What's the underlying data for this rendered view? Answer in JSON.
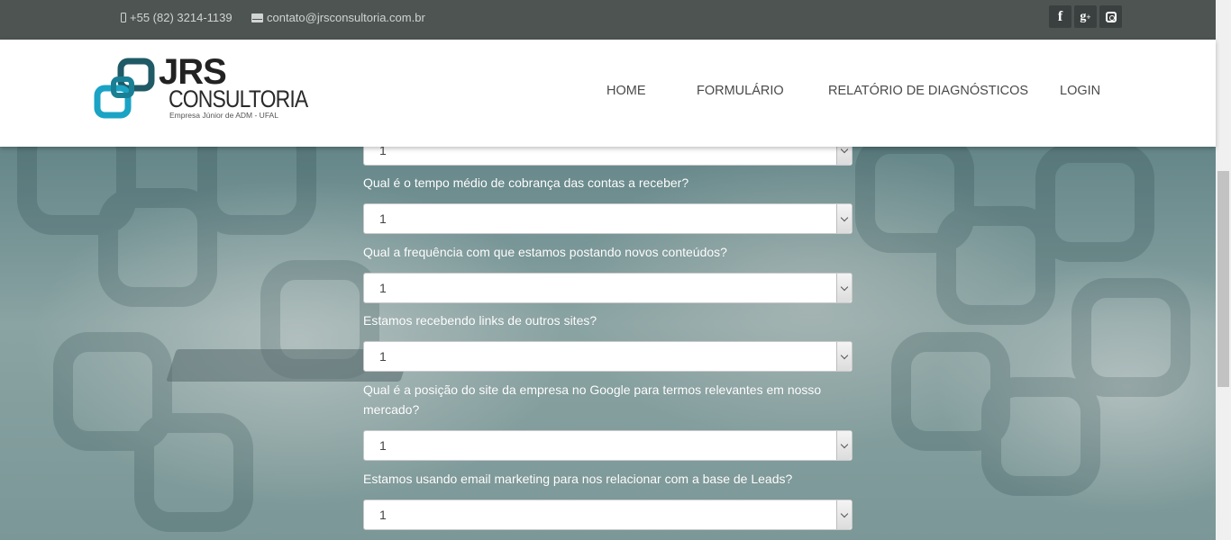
{
  "topbar": {
    "phone": "+55 (82) 3214-1139",
    "email": "contato@jrsconsultoria.com.br",
    "social": [
      "facebook-icon",
      "google-plus-icon",
      "instagram-icon"
    ]
  },
  "logo": {
    "line1": "JRS",
    "line2": "CONSULTORIA",
    "tagline": "Empresa Júnior de ADM - UFAL"
  },
  "nav": {
    "home": "HOME",
    "form": "FORMULÁRIO",
    "report": "RELATÓRIO DE DIAGNÓSTICOS",
    "login": "LOGIN"
  },
  "form": {
    "top_select_value": "1",
    "questions": [
      {
        "label": "Qual é o tempo médio de cobrança das contas a receber?",
        "value": "1"
      },
      {
        "label": "Qual a frequência com que estamos postando novos conteúdos?",
        "value": "1"
      },
      {
        "label": "Estamos recebendo links de outros sites?",
        "value": "1"
      },
      {
        "label": "Qual é a posição do site da empresa no Google para termos relevantes em nosso mercado?",
        "value": "1"
      },
      {
        "label": "Estamos usando email marketing para nos relacionar com a base de Leads?",
        "value": "1"
      }
    ]
  },
  "colors": {
    "topbar": "#4d5452",
    "logo_accent": "#1aa3c4",
    "logo_dark": "#1f5a66"
  }
}
